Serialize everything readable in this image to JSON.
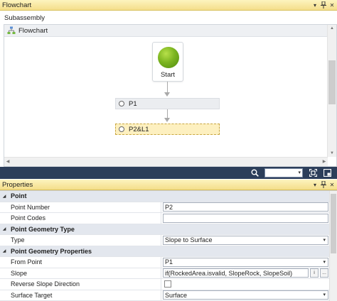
{
  "flowchart_panel": {
    "title": "Flowchart",
    "subassembly_label": "Subassembly",
    "header_label": "Flowchart",
    "start_label": "Start",
    "steps": [
      {
        "label": "P1",
        "selected": false
      },
      {
        "label": "P2&L1",
        "selected": true
      }
    ]
  },
  "properties_panel": {
    "title": "Properties",
    "rows": [
      {
        "type": "category",
        "name": "Point"
      },
      {
        "type": "text",
        "name": "Point Number",
        "value": "P2"
      },
      {
        "type": "text",
        "name": "Point Codes",
        "value": ""
      },
      {
        "type": "category",
        "name": "Point Geometry Type"
      },
      {
        "type": "dropdown",
        "name": "Type",
        "value": "Slope to Surface"
      },
      {
        "type": "category",
        "name": "Point Geometry Properties"
      },
      {
        "type": "dropdown",
        "name": "From Point",
        "value": "P1"
      },
      {
        "type": "expression",
        "name": "Slope",
        "value": "if(RockedArea.isvalid, SlopeRock, SlopeSoil)"
      },
      {
        "type": "checkbox",
        "name": "Reverse Slope Direction",
        "value": ""
      },
      {
        "type": "dropdown",
        "name": "Surface Target",
        "value": "Surface"
      }
    ]
  },
  "colors": {
    "title_bar": "#f4de8a",
    "mid_toolbar": "#2c3e5a",
    "start_node_green": "#7cb520",
    "selected_step": "#fdf0c0"
  },
  "icons": {
    "pin": "pin-icon",
    "close": "close-icon",
    "dropdown": "chevron-down-icon",
    "search": "search-icon",
    "fit": "fit-extents-icon",
    "overview": "overview-icon"
  }
}
